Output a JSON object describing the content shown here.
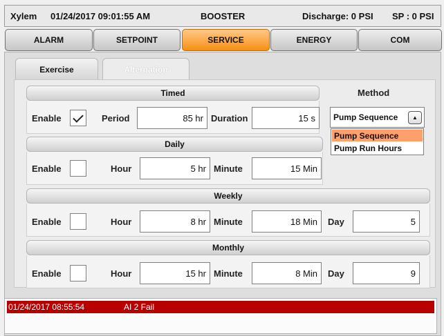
{
  "status": {
    "brand": "Xylem",
    "datetime": "01/24/2017 09:01:55 AM",
    "mode": "BOOSTER",
    "discharge": "Discharge: 0 PSI",
    "setpoint": "SP : 0 PSI"
  },
  "nav": {
    "tabs": [
      {
        "label": "ALARM"
      },
      {
        "label": "SETPOINT"
      },
      {
        "label": "SERVICE"
      },
      {
        "label": "ENERGY"
      },
      {
        "label": "COM"
      }
    ],
    "active": "SERVICE"
  },
  "subtabs": [
    {
      "label": "Exercise"
    },
    {
      "label": "Alternation"
    }
  ],
  "sections": {
    "timed": {
      "title": "Timed",
      "enable_label": "Enable",
      "enabled": true,
      "period_label": "Period",
      "period_value": "85 hr",
      "duration_label": "Duration",
      "duration_value": "15 s"
    },
    "daily": {
      "title": "Daily",
      "enable_label": "Enable",
      "enabled": false,
      "hour_label": "Hour",
      "hour_value": "5 hr",
      "minute_label": "Minute",
      "minute_value": "15 Min"
    },
    "weekly": {
      "title": "Weekly",
      "enable_label": "Enable",
      "enabled": false,
      "hour_label": "Hour",
      "hour_value": "8 hr",
      "minute_label": "Minute",
      "minute_value": "18 Min",
      "day_label": "Day",
      "day_value": "5"
    },
    "monthly": {
      "title": "Monthly",
      "enable_label": "Enable",
      "enabled": false,
      "hour_label": "Hour",
      "hour_value": "15 hr",
      "minute_label": "Minute",
      "minute_value": "8 Min",
      "day_label": "Day",
      "day_value": "9"
    }
  },
  "method": {
    "label": "Method",
    "selected": "Pump Sequence",
    "dropdown_icon": "arrow-up-icon",
    "options": [
      {
        "label": "Pump Sequence",
        "highlighted": true
      },
      {
        "label": "Pump Run Hours",
        "highlighted": false
      }
    ]
  },
  "alarms": [
    {
      "time": "01/24/2017 08:55:54",
      "message": "AI 2 Fail"
    }
  ],
  "colors": {
    "active_tab": "#f78f12",
    "alarm_row": "#b80000",
    "highlighted_option": "#ff9f6b"
  }
}
